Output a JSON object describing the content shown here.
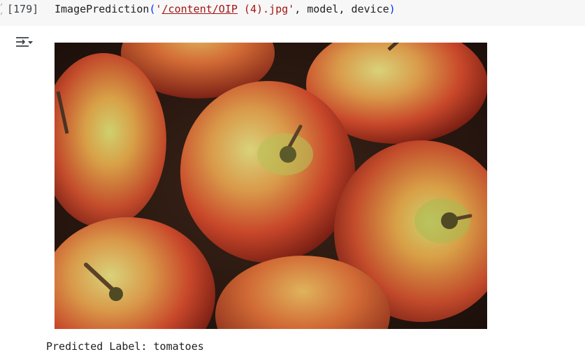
{
  "cell": {
    "execution_count": "[179]",
    "code": {
      "func": "ImagePrediction",
      "open_paren": "(",
      "quote_open": "'",
      "path": "/content/OIP",
      "path_rest": " (4).jpg",
      "quote_close": "'",
      "args_rest": ", model, device",
      "close_paren": ")"
    }
  },
  "output": {
    "toggle_icon": "output-collapse-icon",
    "image_subject": "apples",
    "prediction_text": "Predicted Label: tomatoes"
  },
  "colors": {
    "cell_background": "#f7f7f7",
    "string": "#a31515",
    "paren": "#0431fa",
    "text": "#202124"
  }
}
